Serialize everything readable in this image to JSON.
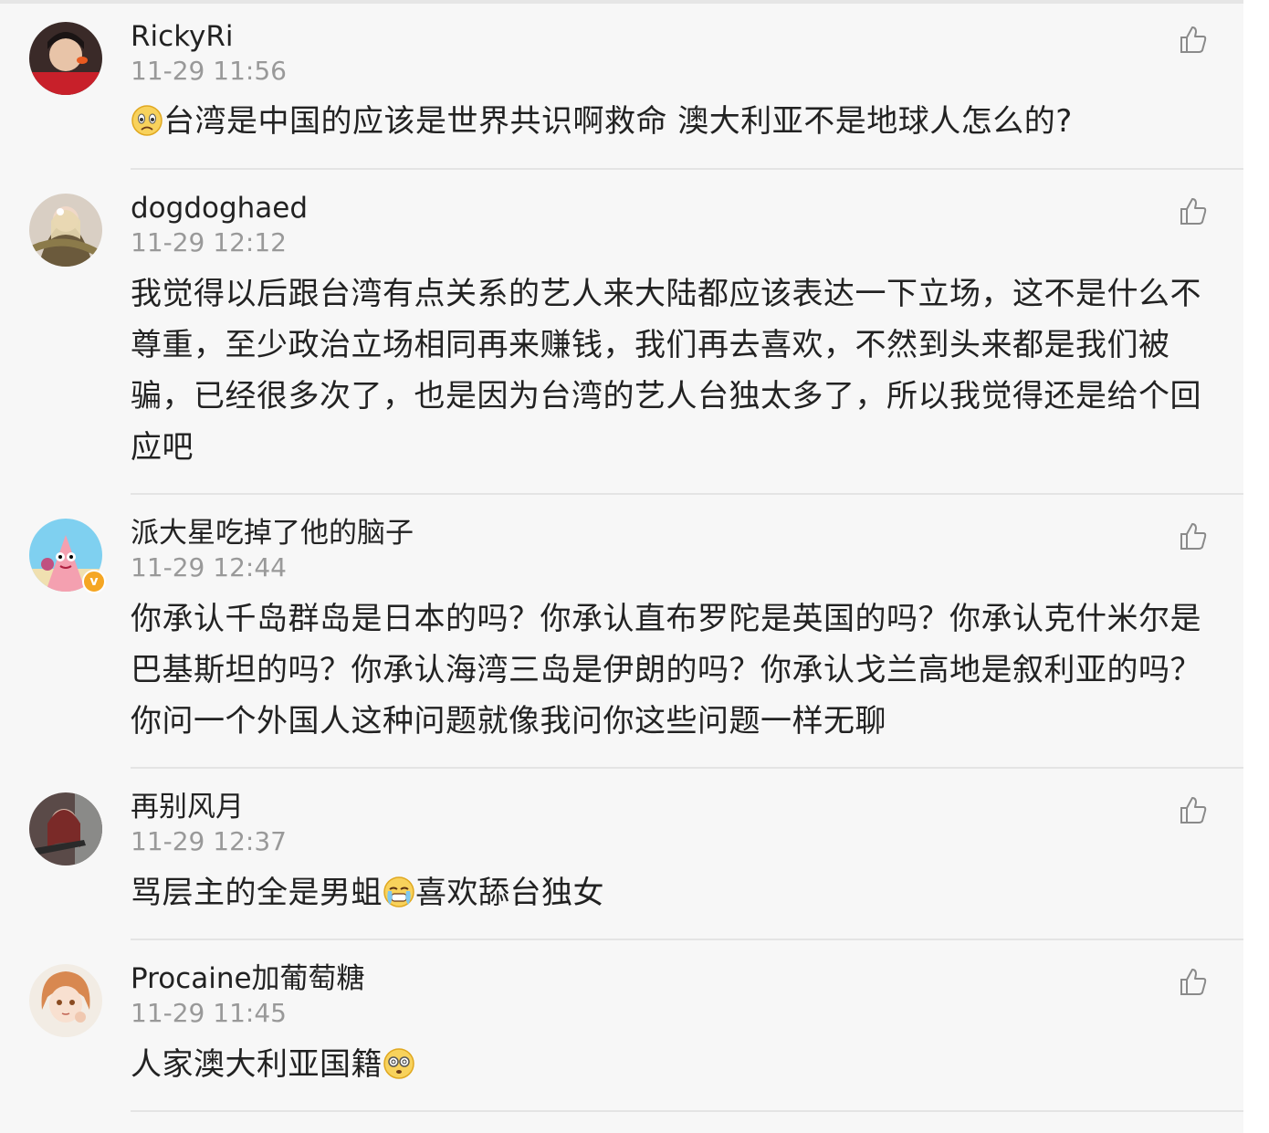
{
  "comments": [
    {
      "username": "RickyRi",
      "time": "11-29 11:56",
      "emoji_before": "worried-face-emoji",
      "text": "台湾是中国的应该是世界共识啊救命 澳大利亚不是地球人怎么的?",
      "emoji_after": ""
    },
    {
      "username": "dogdoghaed",
      "time": "11-29 12:12",
      "text": "我觉得以后跟台湾有点关系的艺人来大陆都应该表达一下立场，这不是什么不尊重，至少政治立场相同再来赚钱，我们再去喜欢，不然到头来都是我们被骗，已经很多次了，也是因为台湾的艺人台独太多了，所以我觉得还是给个回应吧"
    },
    {
      "username": "派大星吃掉了他的脑子",
      "time": "11-29 12:44",
      "verified": true,
      "text": "你承认千岛群岛是日本的吗？你承认直布罗陀是英国的吗？你承认克什米尔是巴基斯坦的吗？你承认海湾三岛是伊朗的吗？你承认戈兰高地是叙利亚的吗？你问一个外国人这种问题就像我问你这些问题一样无聊"
    },
    {
      "username": "再别风月",
      "time": "11-29 12:37",
      "text_a": "骂层主的全是男蛆",
      "emoji_mid": "crying-face-emoji",
      "text_b": "喜欢舔台独女"
    },
    {
      "username": "Procaine加葡萄糖",
      "time": "11-29 11:45",
      "text": "人家澳大利亚国籍",
      "emoji_after": "dizzy-eyes-emoji"
    }
  ],
  "like_icon": "thumbs-up-icon",
  "colors": {
    "background": "#f7f7f7",
    "username": "#222222",
    "time": "#999999",
    "divider": "#e4e4e4",
    "verified_badge": "#f5a623"
  }
}
